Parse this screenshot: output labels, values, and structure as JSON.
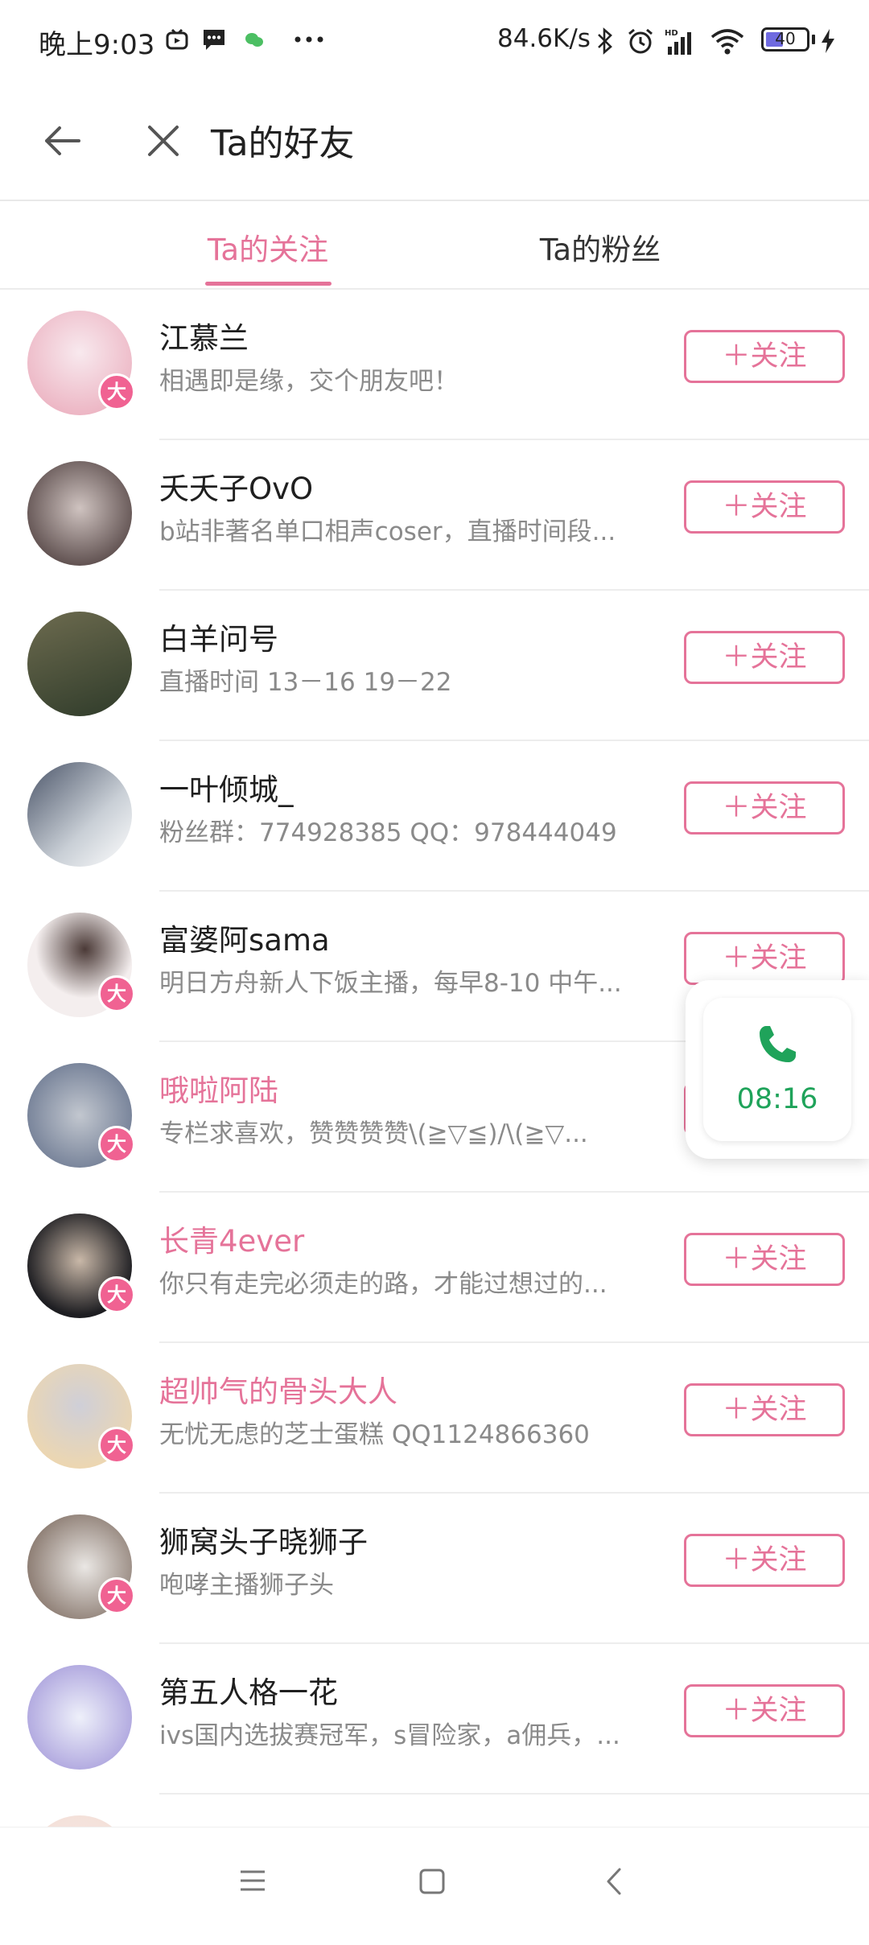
{
  "status_bar": {
    "time": "晚上9:03",
    "net_speed": "84.6K/s",
    "battery": "40"
  },
  "header": {
    "title": "Ta的好友"
  },
  "tabs": [
    {
      "label": "Ta的关注",
      "active": true
    },
    {
      "label": "Ta的粉丝",
      "active": false
    }
  ],
  "follow_label": "＋关注",
  "users": [
    {
      "name": "江慕兰",
      "desc": "相遇即是缘，交个朋友吧！",
      "badge": "大",
      "vip": false,
      "avatar_colors": [
        "#f8e9ee",
        "#e9a6b7"
      ]
    },
    {
      "name": "夭夭子OvO",
      "desc": "b站非著名单口相声coser，直播时间段...",
      "badge": "",
      "vip": false,
      "avatar_colors": [
        "#3a2a2a",
        "#cfc3c0"
      ]
    },
    {
      "name": "白羊问号",
      "desc": "直播时间 13－16 19－22",
      "badge": "",
      "vip": false,
      "avatar_colors": [
        "#2f3b2a",
        "#6d6b4f"
      ]
    },
    {
      "name": "一叶倾城_",
      "desc": "粉丝群：774928385 QQ：978444049",
      "badge": "",
      "vip": false,
      "avatar_colors": [
        "#4a5468",
        "#c9cfd6"
      ]
    },
    {
      "name": "富婆阿sama",
      "desc": "明日方舟新人下饭主播，每早8-10 中午...",
      "badge": "大",
      "vip": false,
      "avatar_colors": [
        "#f4eeee",
        "#4b3a37"
      ]
    },
    {
      "name": "哦啦阿陆",
      "desc": "专栏求喜欢，赞赞赞赞\\(≧▽≦)/\\(≧▽...",
      "badge": "大",
      "vip": true,
      "avatar_colors": [
        "#c2c7cf",
        "#5c6a86"
      ]
    },
    {
      "name": "长青4ever",
      "desc": "你只有走完必须走的路，才能过想过的...",
      "badge": "大",
      "vip": true,
      "avatar_colors": [
        "#1e1e22",
        "#c9b8a8"
      ]
    },
    {
      "name": "超帅气的骨头大人",
      "desc": "无忧无虑的芝士蛋糕 QQ1124866360",
      "badge": "大",
      "vip": true,
      "avatar_colors": [
        "#f6d9a4",
        "#cfcfd8"
      ]
    },
    {
      "name": "狮窝头子晓狮子",
      "desc": "咆哮主播狮子头",
      "badge": "大",
      "vip": false,
      "avatar_colors": [
        "#6e5a4e",
        "#eae7e4"
      ]
    },
    {
      "name": "第五人格一花",
      "desc": "ivs国内选拔赛冠军，s冒险家，a佣兵，...",
      "badge": "",
      "vip": false,
      "avatar_colors": [
        "#eef0fa",
        "#9b8fd6"
      ]
    },
    {
      "name": "",
      "desc": "",
      "badge": "",
      "vip": false,
      "avatar_colors": [
        "#f3ddd5",
        "#f7eae6"
      ]
    }
  ],
  "call_widget": {
    "time": "08:16",
    "icon": "phone-icon",
    "color": "#1fa35a"
  },
  "colors": {
    "accent": "#e57399",
    "badge": "#f06292"
  }
}
